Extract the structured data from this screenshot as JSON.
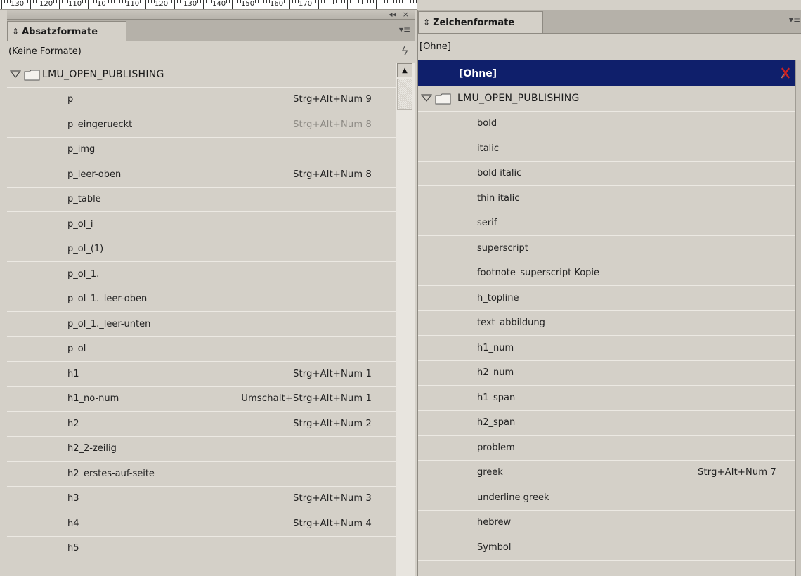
{
  "ruler": {
    "labels": [
      "130",
      "120",
      "110",
      "10",
      "110",
      "120",
      "130",
      "140",
      "150",
      "160",
      "170"
    ]
  },
  "left_panel": {
    "collapse_icon": "double-left-arrow",
    "close_label": "×",
    "tab_title": "Absatzformate",
    "menu_icon": "panel-menu",
    "status_text": "(Keine Formate)",
    "lightning_icon": "quick-apply",
    "group_name": "LMU_OPEN_PUBLISHING",
    "items": [
      {
        "name": "p",
        "shortcut": "Strg+Alt+Num 9",
        "dim": false
      },
      {
        "name": "p_eingerueckt",
        "shortcut": "Strg+Alt+Num 8",
        "dim": true
      },
      {
        "name": "p_img",
        "shortcut": "",
        "dim": false
      },
      {
        "name": "p_leer-oben",
        "shortcut": "Strg+Alt+Num 8",
        "dim": false
      },
      {
        "name": "p_table",
        "shortcut": "",
        "dim": false
      },
      {
        "name": "p_ol_i",
        "shortcut": "",
        "dim": false
      },
      {
        "name": "p_ol_(1)",
        "shortcut": "",
        "dim": false
      },
      {
        "name": "p_ol_1.",
        "shortcut": "",
        "dim": false
      },
      {
        "name": "p_ol_1._leer-oben",
        "shortcut": "",
        "dim": false
      },
      {
        "name": "p_ol_1._leer-unten",
        "shortcut": "",
        "dim": false
      },
      {
        "name": "p_ol",
        "shortcut": "",
        "dim": false
      },
      {
        "name": "h1",
        "shortcut": "Strg+Alt+Num 1",
        "dim": false
      },
      {
        "name": "h1_no-num",
        "shortcut": "Umschalt+Strg+Alt+Num 1",
        "dim": false
      },
      {
        "name": "h2",
        "shortcut": "Strg+Alt+Num 2",
        "dim": false
      },
      {
        "name": "h2_2-zeilig",
        "shortcut": "",
        "dim": false
      },
      {
        "name": "h2_erstes-auf-seite",
        "shortcut": "",
        "dim": false
      },
      {
        "name": "h3",
        "shortcut": "Strg+Alt+Num 3",
        "dim": false
      },
      {
        "name": "h4",
        "shortcut": "Strg+Alt+Num 4",
        "dim": false
      },
      {
        "name": "h5",
        "shortcut": "",
        "dim": false
      }
    ]
  },
  "right_panel": {
    "tab_title": "Zeichenformate",
    "menu_icon": "panel-menu",
    "status_text": "[Ohne]",
    "selected_item": "[Ohne]",
    "selected_icon": "delete-style-x",
    "group_name": "LMU_OPEN_PUBLISHING",
    "items": [
      {
        "name": "bold",
        "shortcut": ""
      },
      {
        "name": "italic",
        "shortcut": ""
      },
      {
        "name": "bold italic",
        "shortcut": ""
      },
      {
        "name": "thin italic",
        "shortcut": ""
      },
      {
        "name": "serif",
        "shortcut": ""
      },
      {
        "name": "superscript",
        "shortcut": ""
      },
      {
        "name": "footnote_superscript Kopie",
        "shortcut": ""
      },
      {
        "name": "h_topline",
        "shortcut": ""
      },
      {
        "name": "text_abbildung",
        "shortcut": ""
      },
      {
        "name": "h1_num",
        "shortcut": ""
      },
      {
        "name": "h2_num",
        "shortcut": ""
      },
      {
        "name": "h1_span",
        "shortcut": ""
      },
      {
        "name": "h2_span",
        "shortcut": ""
      },
      {
        "name": "problem",
        "shortcut": ""
      },
      {
        "name": "greek",
        "shortcut": "Strg+Alt+Num 7"
      },
      {
        "name": "underline greek",
        "shortcut": ""
      },
      {
        "name": "hebrew",
        "shortcut": ""
      },
      {
        "name": "Symbol",
        "shortcut": ""
      }
    ]
  }
}
